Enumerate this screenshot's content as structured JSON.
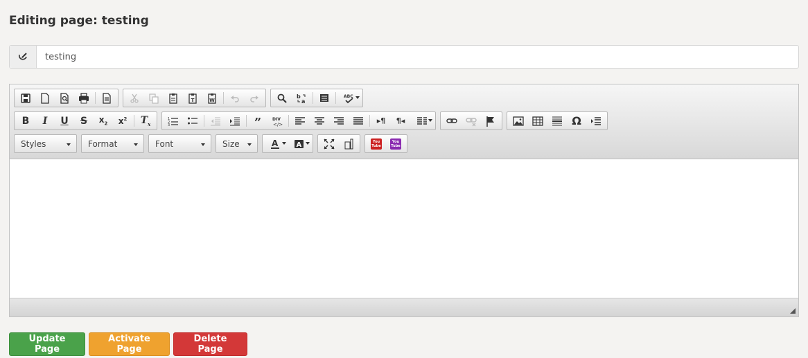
{
  "page": {
    "title": "Editing page: testing"
  },
  "title_field": {
    "value": "testing"
  },
  "editor": {
    "combos": {
      "styles": "Styles",
      "format": "Format",
      "font": "Font",
      "size": "Size"
    },
    "content": ""
  },
  "actions": {
    "update": "Update Page",
    "activate": "Activate Page",
    "delete": "Delete Page"
  },
  "colors": {
    "update": "#4aa24a",
    "activate": "#efa22f",
    "delete": "#d33838",
    "background": "#f4f3f1"
  },
  "icons": {
    "row1": [
      "save-icon",
      "new-page-icon",
      "preview-icon",
      "print-icon",
      "templates-icon",
      "cut-icon",
      "copy-icon",
      "paste-icon",
      "paste-text-icon",
      "paste-word-icon",
      "undo-icon",
      "redo-icon",
      "find-icon",
      "replace-icon",
      "select-all-icon",
      "spellcheck-icon"
    ],
    "row2": [
      "bold-icon",
      "italic-icon",
      "underline-icon",
      "strike-icon",
      "subscript-icon",
      "superscript-icon",
      "remove-format-icon",
      "numbered-list-icon",
      "bulleted-list-icon",
      "outdent-icon",
      "indent-icon",
      "blockquote-icon",
      "div-icon",
      "align-left-icon",
      "align-center-icon",
      "align-right-icon",
      "justify-icon",
      "ltr-icon",
      "rtl-icon",
      "language-icon",
      "link-icon",
      "unlink-icon",
      "anchor-icon",
      "image-icon",
      "table-icon",
      "horizontal-rule-icon",
      "special-char-icon",
      "page-break-icon"
    ],
    "row3": [
      "text-color-icon",
      "bg-color-icon",
      "maximize-icon",
      "show-blocks-icon",
      "youtube-icon",
      "youtube-alt-icon"
    ]
  }
}
